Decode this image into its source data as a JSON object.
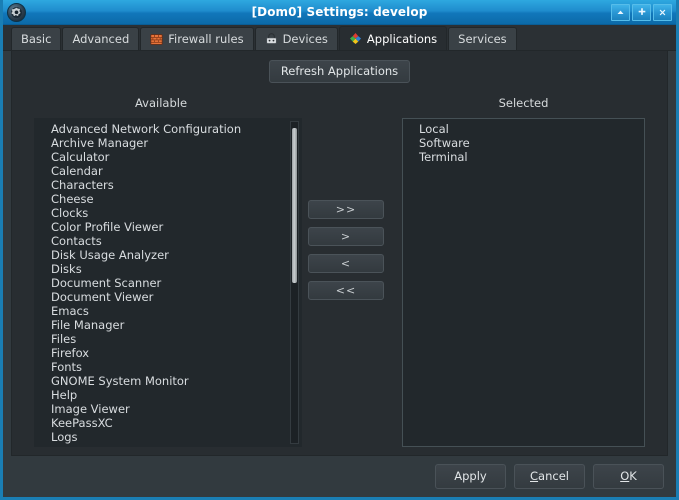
{
  "window": {
    "title": "[Dom0] Settings: develop",
    "app_icon": "settings-gear-icon",
    "controls": [
      {
        "name": "shade-button",
        "icon": "chevron-up-icon",
        "glyph": "▲"
      },
      {
        "name": "maximize-button",
        "icon": "maximize-plus-icon",
        "glyph": "✚"
      },
      {
        "name": "close-button",
        "icon": "close-x-icon",
        "glyph": "✕"
      }
    ],
    "accent_color": "#1f8ccd",
    "chrome_color": "#323a3f",
    "pane_color": "#282d31"
  },
  "tabs": [
    {
      "label": "Basic",
      "icon": null,
      "active": false
    },
    {
      "label": "Advanced",
      "icon": null,
      "active": false
    },
    {
      "label": "Firewall rules",
      "icon": "firewall-icon",
      "active": false
    },
    {
      "label": "Devices",
      "icon": "devices-icon",
      "active": false
    },
    {
      "label": "Applications",
      "icon": "applications-icon",
      "active": true
    },
    {
      "label": "Services",
      "icon": null,
      "active": false
    }
  ],
  "toolbar": {
    "refresh_label": "Refresh Applications"
  },
  "available": {
    "header": "Available",
    "items": [
      "Advanced Network Configuration",
      "Archive Manager",
      "Calculator",
      "Calendar",
      "Characters",
      "Cheese",
      "Clocks",
      "Color Profile Viewer",
      "Contacts",
      "Disk Usage Analyzer",
      "Disks",
      "Document Scanner",
      "Document Viewer",
      "Emacs",
      "File Manager",
      "Files",
      "Firefox",
      "Fonts",
      "GNOME System Monitor",
      "Help",
      "Image Viewer",
      "KeePassXC",
      "Logs"
    ]
  },
  "selected": {
    "header": "Selected",
    "items": [
      "Local",
      "Software",
      "Terminal"
    ]
  },
  "transfer_buttons": [
    {
      "label": ">>",
      "name": "add-all-button"
    },
    {
      "label": ">",
      "name": "add-button"
    },
    {
      "label": "<",
      "name": "remove-button"
    },
    {
      "label": "<<",
      "name": "remove-all-button"
    }
  ],
  "footer": {
    "apply_label": "Apply",
    "cancel_label": "Cancel",
    "cancel_mnemonic": "C",
    "ok_label": "OK",
    "ok_mnemonic": "O"
  }
}
